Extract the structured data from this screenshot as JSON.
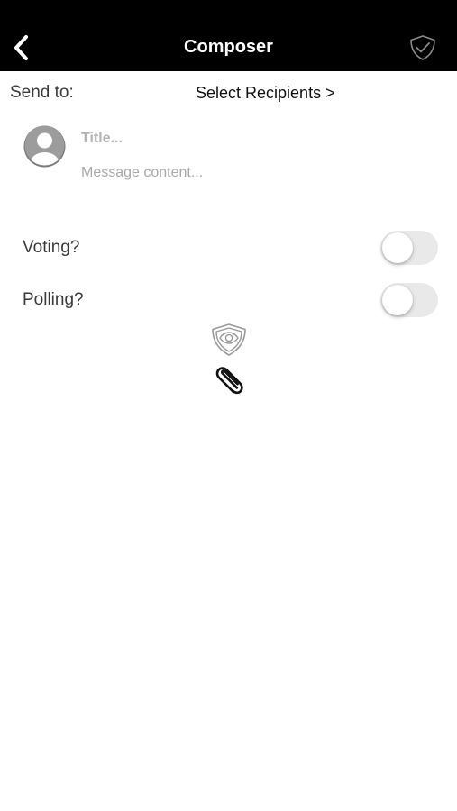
{
  "header": {
    "title": "Composer",
    "back_icon": "chevron-left-icon",
    "action_icon": "shield-check-icon",
    "background": "#000000"
  },
  "recipients": {
    "label": "Send to:",
    "link_text": "Select Recipients >"
  },
  "message": {
    "avatar_icon": "user-avatar-icon",
    "title_placeholder": "Title...",
    "title_value": "",
    "content_placeholder": "Message content...",
    "content_value": ""
  },
  "options": [
    {
      "label": "Voting?",
      "enabled": false
    },
    {
      "label": "Polling?",
      "enabled": false
    }
  ],
  "tools": {
    "privacy_icon": "shield-eye-icon",
    "attach_icon": "paperclip-icon"
  }
}
